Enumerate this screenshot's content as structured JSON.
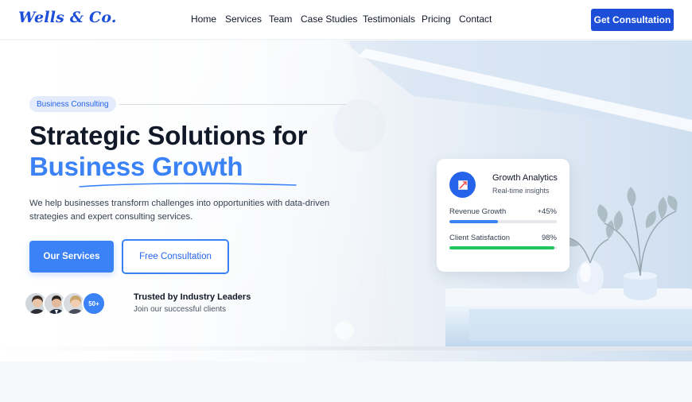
{
  "nav": {
    "logo": "Wells & Co.",
    "links": [
      "Home",
      "Services",
      "Team",
      "Case Studies",
      "Testimonials",
      "Pricing",
      "Contact"
    ],
    "cta": "Get Consultation"
  },
  "hero": {
    "badge": "Business Consulting",
    "headline_line1": "Strategic Solutions for",
    "headline_line2": "Business Growth",
    "description": "We help businesses transform challenges into opportunities with data-driven strategies and expert consulting services.",
    "primary_button": "Our Services",
    "secondary_button": "Free Consultation",
    "avatar_count": "50+",
    "trust_title": "Trusted by Industry Leaders",
    "trust_subtitle": "Join our successful clients"
  },
  "card": {
    "title": "Growth Analytics",
    "subtitle": "Real-time insights",
    "icon": "chart-icon",
    "metrics": [
      {
        "label": "Revenue Growth",
        "value": "+45%",
        "fraction": 0.45,
        "color": "#3b82f6"
      },
      {
        "label": "Client Satisfaction",
        "value": "98%",
        "fraction": 0.98,
        "color": "#22c55e"
      }
    ]
  },
  "colors": {
    "brand": "#1d4ed8",
    "accent": "#3b82f6",
    "success": "#22c55e"
  }
}
